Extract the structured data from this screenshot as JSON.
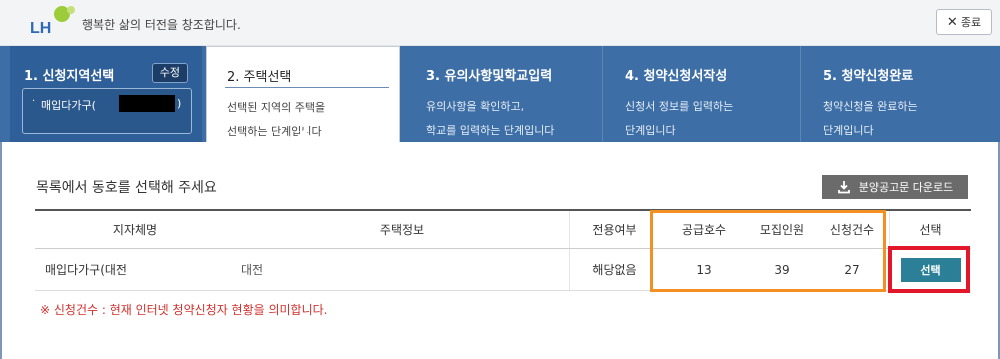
{
  "header": {
    "logo_text": "LH",
    "slogan": "행복한 삶의 터전을 창조합니다.",
    "close_label": "종료",
    "colors": {
      "logo_green": "#9ccc3a",
      "logo_blue": "#2d6cb5"
    }
  },
  "steps": [
    {
      "title": "1. 신청지역선택",
      "edit_label": "수정",
      "selected_bullet": "·",
      "selected_label": "매입다가구(",
      "selected_suffix": ")"
    },
    {
      "title": "2. 주택선택",
      "desc_line1": "선택된 지역의 주택을",
      "desc_line2": "선택하는 단계입니다"
    },
    {
      "title": "3. 유의사항및학교입력",
      "desc_line1": "유의사항을 확인하고,",
      "desc_line2": "학교를 입력하는 단계입니다"
    },
    {
      "title": "4. 청약신청서작성",
      "desc_line1": "신청서 정보를 입력하는",
      "desc_line2": "단계입니다"
    },
    {
      "title": "5. 청약신청완료",
      "desc_line1": "청약신청을 완료하는",
      "desc_line2": "단계입니다"
    }
  ],
  "content": {
    "section_title": "목록에서 동호를 선택해 주세요",
    "download_label": "분양공고문 다운로드",
    "columns": [
      "지자체명",
      "주택정보",
      "전용여부",
      "공급호수",
      "모집인원",
      "신청건수",
      "선택"
    ],
    "rows": [
      {
        "region": "매입다가구(대전",
        "house_info": "대전",
        "exclusive": "해당없음",
        "supply": "13",
        "recruit": "39",
        "applications": "27",
        "select_label": "선택"
      }
    ],
    "note": "※ 신청건수 : 현재 인터넷 청약신청자 현황을 의미합니다."
  },
  "colors": {
    "stepper_bg": "#3d6ea6",
    "select_button": "#2b7f96",
    "highlight_orange": "#f39021",
    "highlight_red": "#e2182a",
    "note_red": "#d0312d"
  }
}
